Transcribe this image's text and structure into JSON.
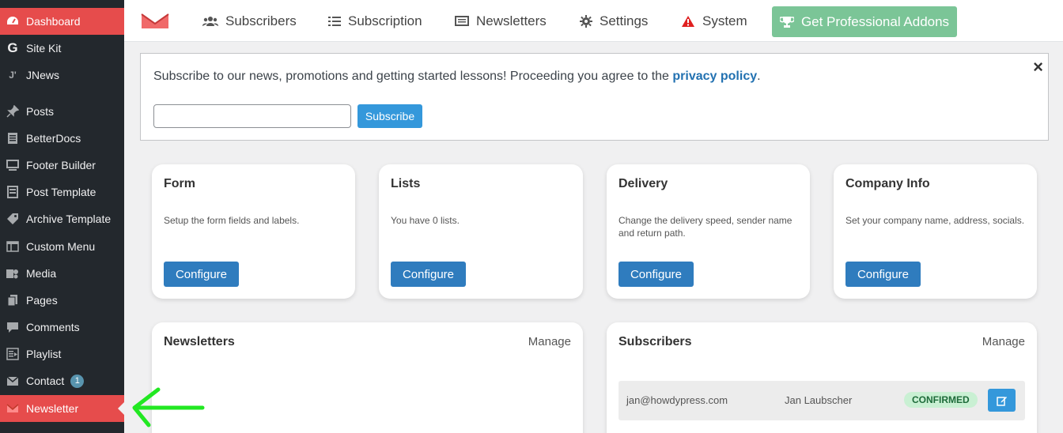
{
  "sidebar": {
    "items": [
      {
        "label": "Dashboard",
        "icon": "dashboard-icon"
      },
      {
        "label": "Site Kit",
        "icon": "google-g-icon"
      },
      {
        "label": "JNews",
        "icon": "jnews-icon"
      },
      {
        "label": "Posts",
        "icon": "pin-icon"
      },
      {
        "label": "BetterDocs",
        "icon": "docs-icon"
      },
      {
        "label": "Footer Builder",
        "icon": "monitor-icon"
      },
      {
        "label": "Post Template",
        "icon": "template-icon"
      },
      {
        "label": "Archive Template",
        "icon": "tag-icon"
      },
      {
        "label": "Custom Menu",
        "icon": "menu-icon"
      },
      {
        "label": "Media",
        "icon": "media-icon"
      },
      {
        "label": "Pages",
        "icon": "pages-icon"
      },
      {
        "label": "Comments",
        "icon": "comment-icon"
      },
      {
        "label": "Playlist",
        "icon": "playlist-icon"
      },
      {
        "label": "Contact",
        "icon": "envelope-icon",
        "badge": "1"
      },
      {
        "label": "Newsletter",
        "icon": "newsletter-logo-icon"
      }
    ]
  },
  "topnav": {
    "subscribers": "Subscribers",
    "subscription": "Subscription",
    "newsletters": "Newsletters",
    "settings": "Settings",
    "system": "System",
    "pro": "Get Professional Addons"
  },
  "notice": {
    "text_before": "Subscribe to our news, promotions and getting started lessons! Proceeding you agree to the ",
    "link": "privacy policy",
    "text_after": ".",
    "close": "×",
    "input_value": "",
    "button": "Subscribe"
  },
  "cards": {
    "form": {
      "title": "Form",
      "desc": "Setup the form fields and labels.",
      "button": "Configure"
    },
    "lists": {
      "title": "Lists",
      "desc": "You have 0 lists.",
      "button": "Configure"
    },
    "delivery": {
      "title": "Delivery",
      "desc": "Change the delivery speed, sender name and return path.",
      "button": "Configure"
    },
    "company": {
      "title": "Company Info",
      "desc": "Set your company name, address, socials.",
      "button": "Configure"
    }
  },
  "newsletters_panel": {
    "title": "Newsletters",
    "manage": "Manage"
  },
  "subscribers_panel": {
    "title": "Subscribers",
    "manage": "Manage",
    "rows": [
      {
        "email": "jan@howdypress.com",
        "name": "Jan Laubscher",
        "status": "CONFIRMED"
      }
    ]
  },
  "colors": {
    "sidebar_bg": "#23282d",
    "active_red": "#e64c4c",
    "pro_green": "#7bc597",
    "primary_blue": "#2f7cbe",
    "annotation_arrow": "#22e822"
  }
}
